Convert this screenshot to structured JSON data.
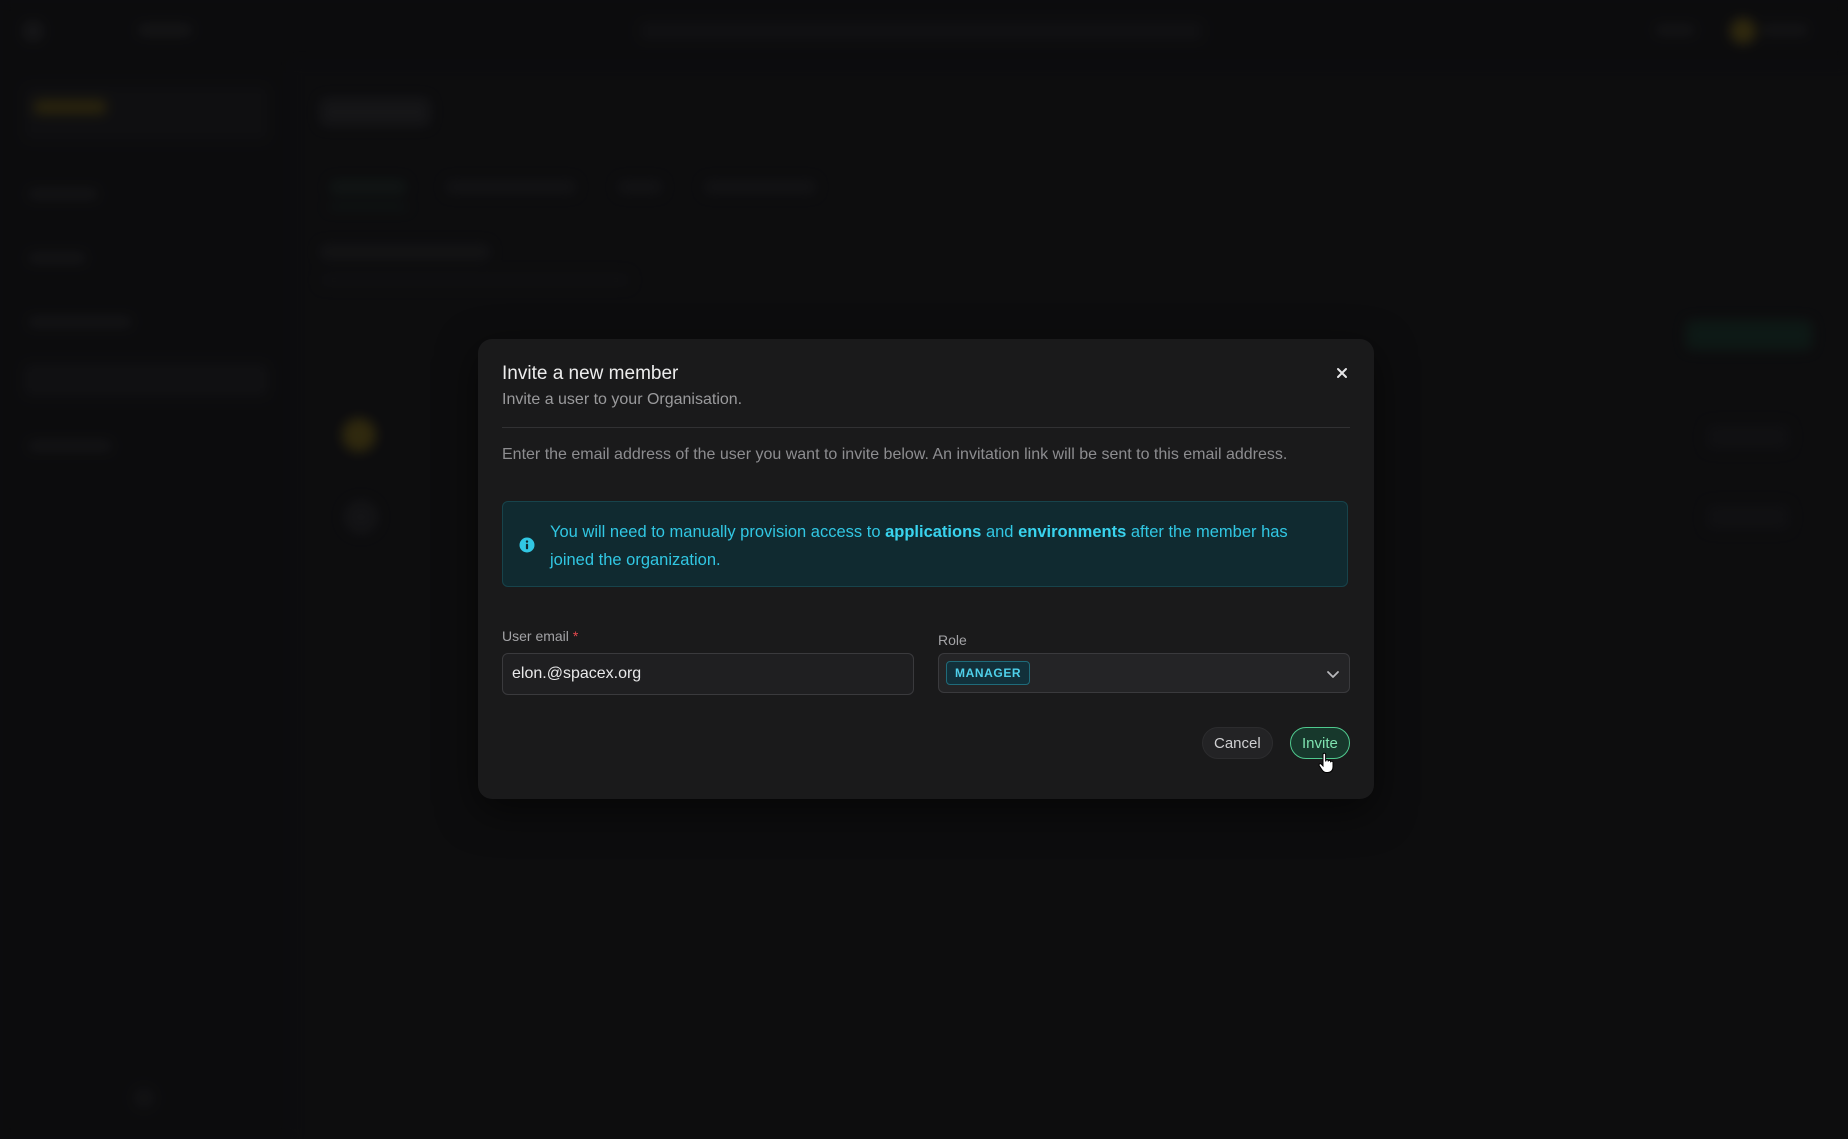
{
  "modal": {
    "title": "Invite a new member",
    "subtitle": "Invite a user to your Organisation.",
    "intro": "Enter the email address of the user you want to invite below. An invitation link will be sent to this email address.",
    "alert": {
      "text_before": "You will need to manually provision access to ",
      "bold_1": "applications",
      "text_mid": " and ",
      "bold_2": "environments",
      "text_after": " after the member has joined the organization."
    },
    "email": {
      "label": "User email",
      "required_mark": "*",
      "value": "elon.@spacex.org"
    },
    "role": {
      "label": "Role",
      "selected": "MANAGER"
    },
    "buttons": {
      "cancel": "Cancel",
      "invite": "Invite"
    }
  },
  "colors": {
    "accent_green": "#4fc98e",
    "info_cyan": "#31c7e3",
    "required_red": "#e5484d"
  },
  "icons": [
    "close-icon",
    "info-icon",
    "chevron-down-icon",
    "hand-cursor-icon"
  ]
}
